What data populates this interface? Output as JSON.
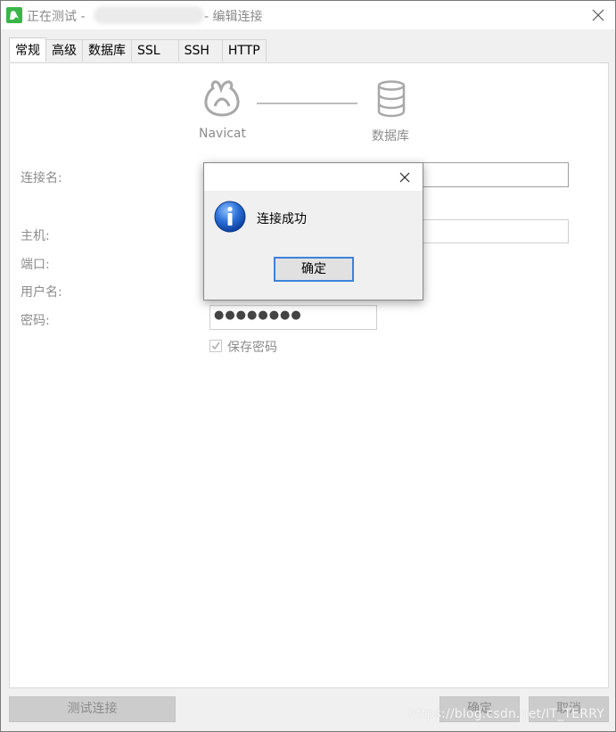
{
  "window": {
    "title_prefix": "正在测试 - ",
    "title_suffix": "- 编辑连接"
  },
  "tabs": [
    {
      "label": "常规",
      "active": true
    },
    {
      "label": "高级"
    },
    {
      "label": "数据库"
    },
    {
      "label": "SSL"
    },
    {
      "label": "SSH"
    },
    {
      "label": "HTTP"
    }
  ],
  "diagram": {
    "left_label": "Navicat",
    "right_label": "数据库"
  },
  "form": {
    "connection_name_label": "连接名:",
    "host_label": "主机:",
    "port_label": "端口:",
    "username_label": "用户名:",
    "password_label": "密码:",
    "password_value": "●●●●●●●●",
    "save_password_label": "保存密码",
    "save_password_checked": true
  },
  "buttons": {
    "test": "测试连接",
    "ok": "确定",
    "cancel": "取消"
  },
  "watermark": "https://blog.csdn.net/IT_TERRY",
  "dialog": {
    "message": "连接成功",
    "ok": "确定"
  },
  "colors": {
    "app_icon": "#3bb54a",
    "focus_border": "#3c82d8",
    "info_icon": "#1a5cc8"
  }
}
